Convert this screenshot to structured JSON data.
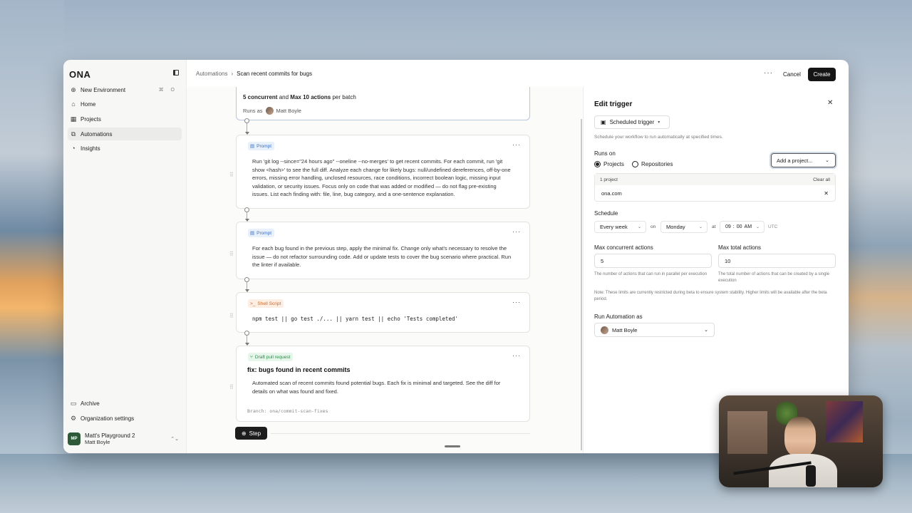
{
  "app": {
    "logo": "ONA"
  },
  "sidebar": {
    "items": [
      {
        "label": "New Environment",
        "icon": "plus-circle-icon",
        "shortcut": "⌘ O"
      },
      {
        "label": "Home",
        "icon": "home-icon"
      },
      {
        "label": "Projects",
        "icon": "grid-icon"
      },
      {
        "label": "Automations",
        "icon": "automation-icon",
        "active": true
      },
      {
        "label": "Insights",
        "icon": "insights-icon"
      }
    ],
    "bottom": [
      {
        "label": "Archive",
        "icon": "archive-icon"
      },
      {
        "label": "Organization settings",
        "icon": "gear-icon"
      }
    ],
    "workspace": {
      "initials": "MP",
      "name": "Matt's Playground 2",
      "user": "Matt Boyle"
    }
  },
  "header": {
    "breadcrumb": [
      "Automations",
      "Scan recent commits for bugs"
    ],
    "cancel": "Cancel",
    "create": "Create"
  },
  "canvas": {
    "trigger_card": {
      "limits_prefix": "5 concurrent",
      "limits_and": "and",
      "limits_max": "Max 10 actions",
      "limits_suffix": "per batch",
      "runs_as_label": "Runs as",
      "runs_as_user": "Matt Boyle"
    },
    "steps": [
      {
        "type": "Prompt",
        "text": "Run 'git log --since=\"24 hours ago\" --oneline --no-merges' to get recent commits. For each commit, run 'git show <hash>' to see the full diff. Analyze each change for likely bugs: null/undefined dereferences, off-by-one errors, missing error handling, unclosed resources, race conditions, incorrect boolean logic, missing input validation, or security issues. Focus only on code that was added or modified — do not flag pre-existing issues. List each finding with: file, line, bug category, and a one-sentence explanation."
      },
      {
        "type": "Prompt",
        "text": "For each bug found in the previous step, apply the minimal fix. Change only what's necessary to resolve the issue — do not refactor surrounding code. Add or update tests to cover the bug scenario where practical. Run the linter if available."
      },
      {
        "type": "Shell Script",
        "text": "npm test || go test ./... || yarn test || echo 'Tests completed'"
      },
      {
        "type": "Draft pull request",
        "title": "fix: bugs found in recent commits",
        "text": "Automated scan of recent commits found potential bugs. Each fix is minimal and targeted. See the diff for details on what was found and fixed.",
        "branch": "Branch: ona/commit-scan-fixes"
      }
    ],
    "step_button": "Step"
  },
  "panel": {
    "title": "Edit trigger",
    "trigger_type": "Scheduled trigger",
    "trigger_help": "Schedule your workflow to run automatically at specified times.",
    "runs_on_label": "Runs on",
    "radio_projects": "Projects",
    "radio_repos": "Repositories",
    "add_project": "Add a project...",
    "project_count": "1 project",
    "clear_all": "Clear all",
    "project_name": "ona.com",
    "schedule_label": "Schedule",
    "frequency": "Every week",
    "on_label": "on",
    "day": "Monday",
    "at_label": "at",
    "time_h": "09",
    "time_m": "00",
    "time_ampm": "AM",
    "tz": "UTC",
    "max_concurrent_label": "Max concurrent actions",
    "max_concurrent_value": "5",
    "max_concurrent_help": "The number of actions that can run in parallel per execution",
    "max_total_label": "Max total actions",
    "max_total_value": "10",
    "max_total_help": "The total number of actions that can be created by a single execution",
    "note": "Note: These limits are currently restricted during beta to ensure system stability. Higher limits will be available after the beta period.",
    "run_as_label": "Run Automation as",
    "run_as_user": "Matt Boyle"
  }
}
